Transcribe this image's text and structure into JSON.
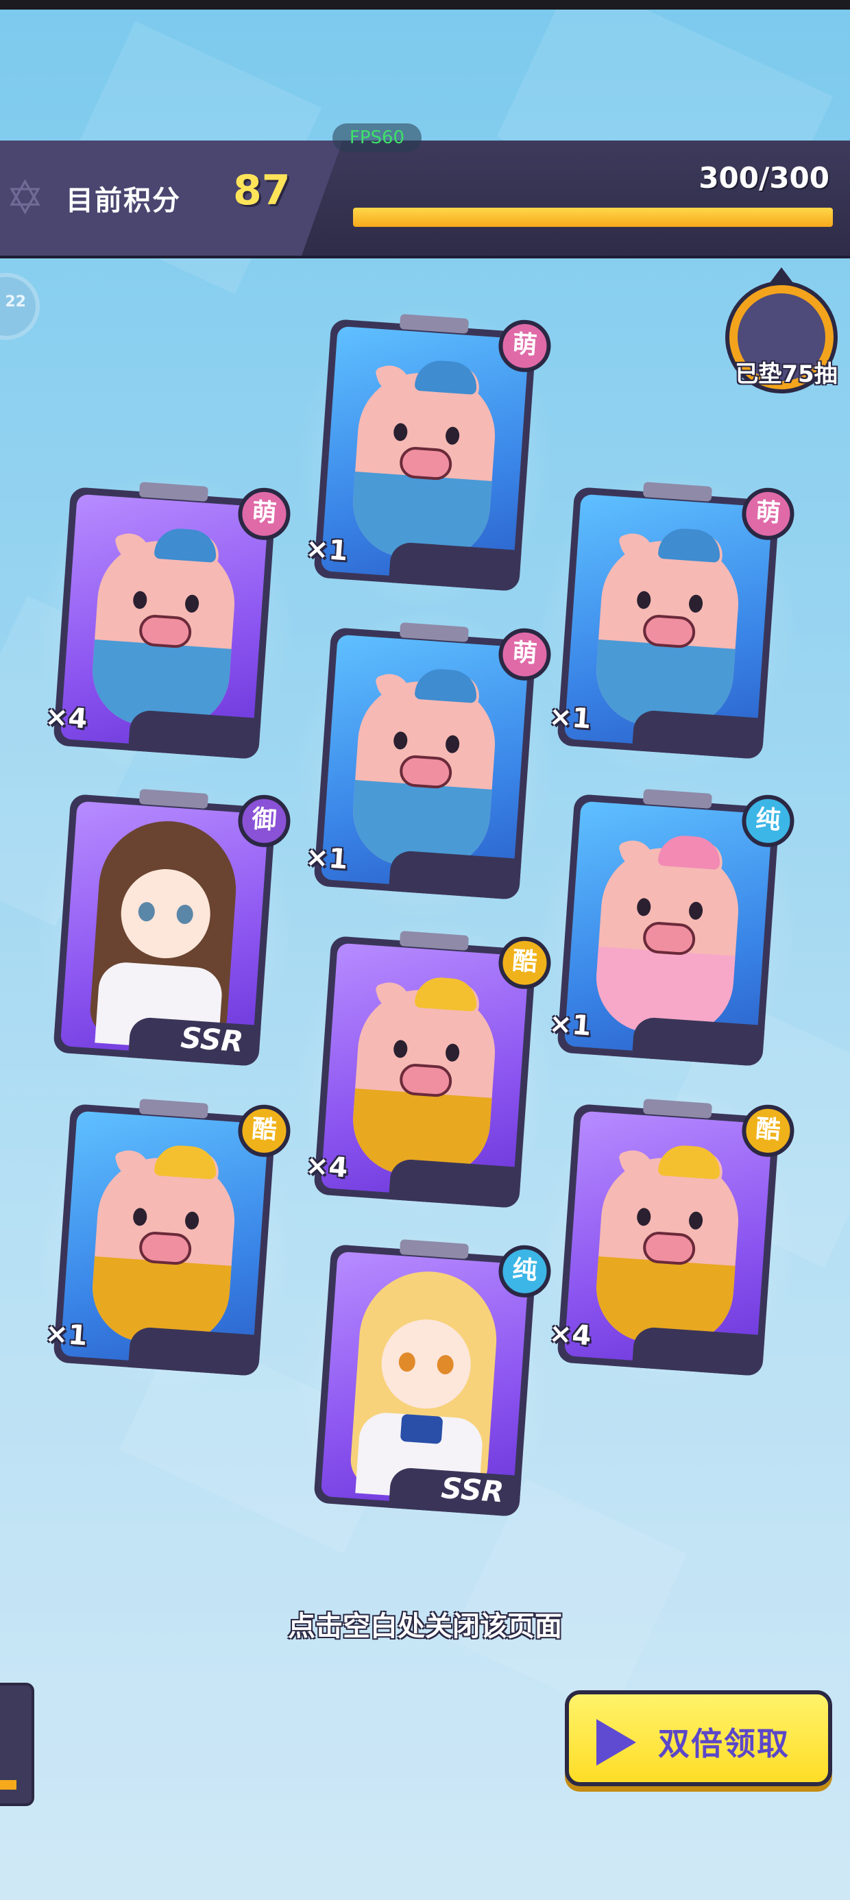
{
  "header": {
    "score_label": "目前积分",
    "score_value": "87",
    "progress_text": "300/300",
    "progress_fraction": 1.0,
    "fps": "FPS60"
  },
  "side_badge": {
    "text": "22"
  },
  "pity": {
    "label": "已垫75抽"
  },
  "cards": [
    {
      "trait": "萌",
      "count": "×1",
      "type": "pig",
      "variant": "blue",
      "frame": "blue"
    },
    {
      "trait": "萌",
      "count": "×4",
      "type": "pig",
      "variant": "blue",
      "frame": "purple"
    },
    {
      "trait": "萌",
      "count": "×1",
      "type": "pig",
      "variant": "blue",
      "frame": "blue"
    },
    {
      "trait": "萌",
      "count": "×1",
      "type": "pig",
      "variant": "blue",
      "frame": "blue"
    },
    {
      "trait": "御",
      "ssr": "SSR",
      "type": "girl",
      "variant": "brown",
      "frame": "purple"
    },
    {
      "trait": "纯",
      "count": "×1",
      "type": "pig",
      "variant": "pink",
      "frame": "blue"
    },
    {
      "trait": "酷",
      "count": "×4",
      "type": "pig",
      "variant": "gold",
      "frame": "purple"
    },
    {
      "trait": "酷",
      "count": "×1",
      "type": "pig",
      "variant": "gold",
      "frame": "blue"
    },
    {
      "trait": "酷",
      "count": "×4",
      "type": "pig",
      "variant": "gold",
      "frame": "purple"
    },
    {
      "trait": "纯",
      "ssr": "SSR",
      "type": "girl",
      "variant": "blonde",
      "frame": "purple"
    }
  ],
  "trait_colors": {
    "萌": "#e06aa8",
    "御": "#8a52d6",
    "纯": "#3cb6e6",
    "酷": "#f0b21a"
  },
  "hint": "点击空白处关闭该页面",
  "double_button": {
    "label": "双倍领取",
    "icon": "play-icon"
  }
}
